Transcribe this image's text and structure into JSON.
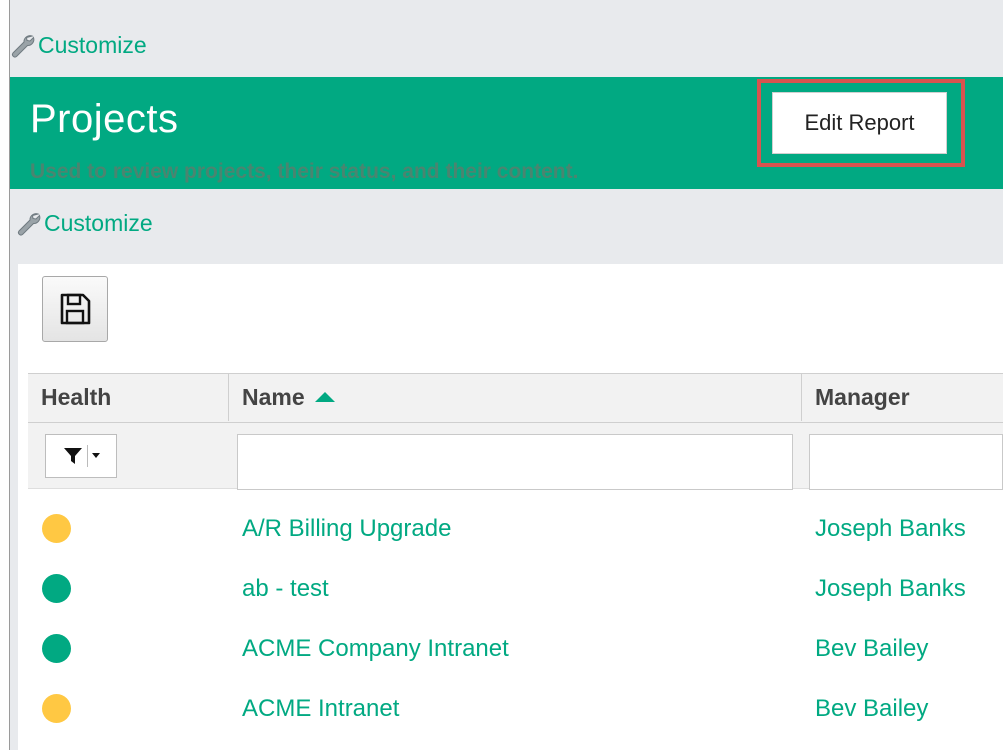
{
  "customize_top": {
    "label": "Customize"
  },
  "banner": {
    "title": "Projects",
    "subtitle": "Used to review projects, their status, and their content.",
    "edit_label": "Edit Report"
  },
  "customize_mid": {
    "label": "Customize"
  },
  "toolbar": {
    "save_icon": "save-icon"
  },
  "table": {
    "columns": [
      {
        "label": "Health"
      },
      {
        "label": "Name",
        "sort": "ascending"
      },
      {
        "label": "Manager"
      }
    ],
    "filter": {
      "icon": "filter-icon",
      "name_value": "",
      "manager_value": ""
    },
    "rows": [
      {
        "health": "yellow",
        "name": "A/R Billing Upgrade",
        "manager": "Joseph Banks"
      },
      {
        "health": "green",
        "name": "ab - test",
        "manager": "Joseph Banks"
      },
      {
        "health": "green",
        "name": "ACME Company Intranet",
        "manager": "Bev Bailey"
      },
      {
        "health": "yellow",
        "name": "ACME Intranet",
        "manager": "Bev Bailey"
      }
    ]
  },
  "colors": {
    "accent": "#01a982",
    "health_yellow": "#ffc843",
    "health_green": "#01a982",
    "highlight": "#d9534f"
  }
}
